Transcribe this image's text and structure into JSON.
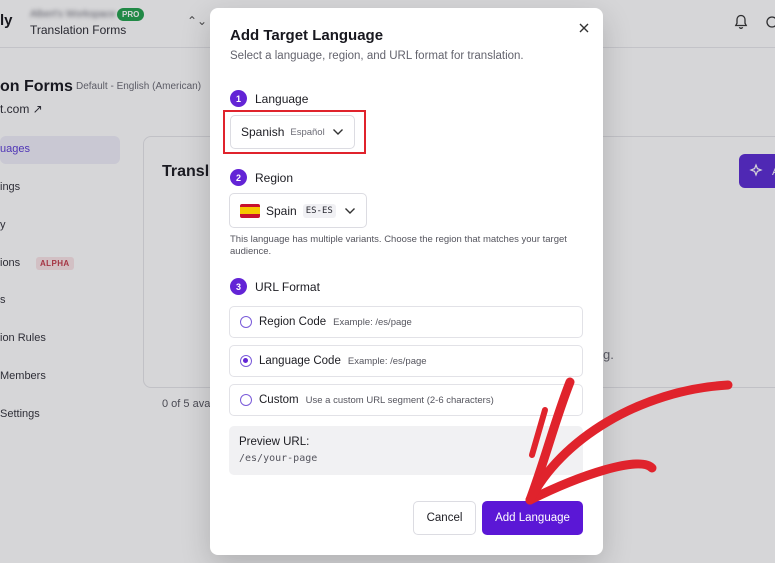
{
  "app": {
    "brand": "ly",
    "workspace_name": "Albert's Workspace",
    "pro_badge": "PRO",
    "workspace_sub": "Translation Forms",
    "switcher_glyph": "⌃⌄",
    "page_title": "on Forms",
    "page_sub": "Default - English (American)",
    "page_link": "t.com ↗",
    "sidebar": [
      {
        "label": "uages",
        "active": true
      },
      {
        "label": "ings"
      },
      {
        "label": "y"
      },
      {
        "label": "ions"
      },
      {
        "label": "s"
      },
      {
        "label": "ion Rules"
      },
      {
        "label": "Members"
      },
      {
        "label": "Settings"
      }
    ],
    "alpha_badge": "ALPHA",
    "card_title": "Transl",
    "card_text1": "l",
    "card_text2": "g.",
    "count_text": "0 of 5 ava"
  },
  "modal": {
    "title": "Add Target Language",
    "subtitle": "Select a language, region, and URL format for translation.",
    "close_glyph": "×",
    "steps": [
      {
        "num": "1",
        "label": "Language"
      },
      {
        "num": "2",
        "label": "Region"
      },
      {
        "num": "3",
        "label": "URL Format"
      }
    ],
    "language": {
      "name": "Spanish",
      "native": "Español"
    },
    "region": {
      "name": "Spain",
      "code": "ES-ES"
    },
    "region_hint": "This language has multiple variants. Choose the region that matches your target audience.",
    "url_options": [
      {
        "label": "Region Code",
        "example": "Example: /es/page",
        "checked": false
      },
      {
        "label": "Language Code",
        "example": "Example: /es/page",
        "checked": true
      },
      {
        "label": "Custom",
        "example": "Use a custom URL segment (2-6 characters)",
        "checked": false
      }
    ],
    "preview_label": "Preview URL:",
    "preview_value": "/es/your-page",
    "cancel": "Cancel",
    "add": "Add Language"
  },
  "colors": {
    "accent": "#5b17d6",
    "annotation": "#e0232c"
  }
}
